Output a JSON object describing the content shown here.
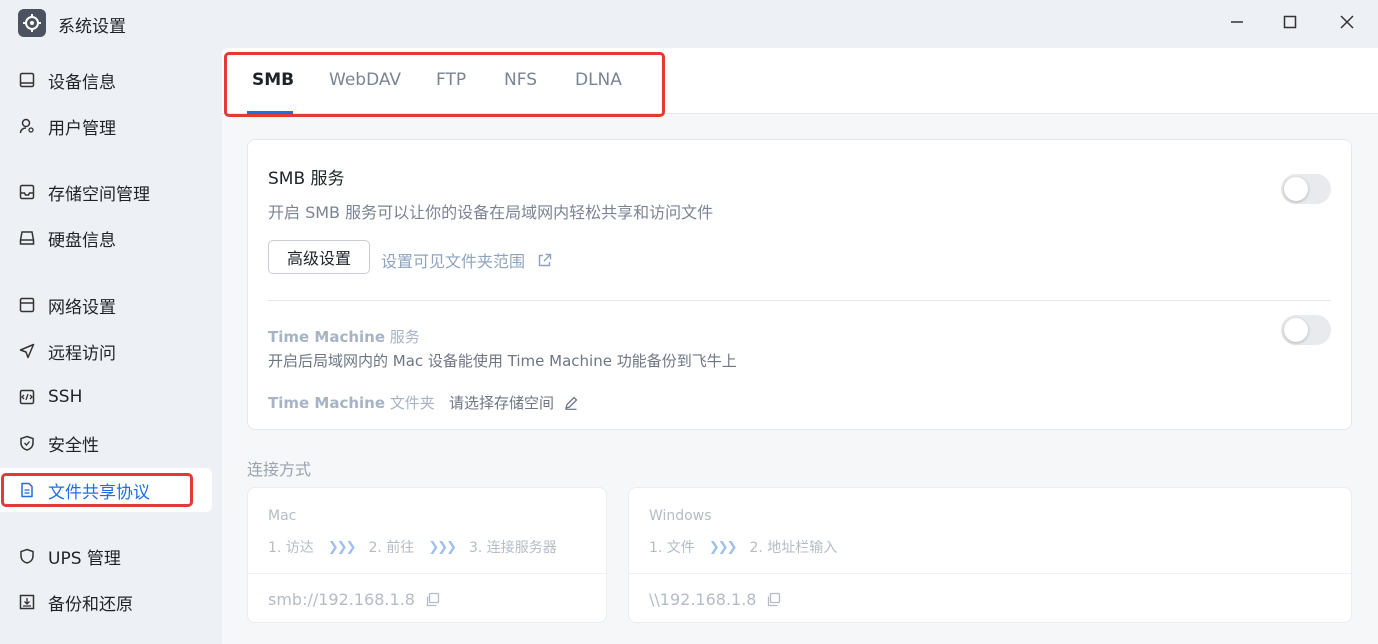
{
  "window": {
    "title": "系统设置",
    "controls": [
      "minimize-icon",
      "maximize-icon",
      "close-icon"
    ]
  },
  "sidebar": {
    "items": [
      {
        "label": "设备信息",
        "icon": "device-info-icon"
      },
      {
        "label": "用户管理",
        "icon": "user-manage-icon"
      },
      {
        "label": "存储空间管理",
        "icon": "storage-icon"
      },
      {
        "label": "硬盘信息",
        "icon": "disk-icon"
      },
      {
        "label": "网络设置",
        "icon": "network-icon"
      },
      {
        "label": "远程访问",
        "icon": "remote-access-icon"
      },
      {
        "label": "SSH",
        "icon": "ssh-icon"
      },
      {
        "label": "安全性",
        "icon": "shield-icon"
      },
      {
        "label": "文件共享协议",
        "icon": "file-share-icon",
        "active": true
      },
      {
        "label": "UPS 管理",
        "icon": "ups-shield-icon"
      },
      {
        "label": "备份和还原",
        "icon": "backup-icon"
      }
    ]
  },
  "tabs": [
    "SMB",
    "WebDAV",
    "FTP",
    "NFS",
    "DLNA"
  ],
  "active_tab": "SMB",
  "smb": {
    "title": "SMB 服务",
    "desc": "开启 SMB 服务可以让你的设备在局域网内轻松共享和访问文件",
    "enabled": false,
    "advanced_button": "高级设置",
    "scope_link": "设置可见文件夹范围"
  },
  "time_machine": {
    "title_bold": "Time Machine",
    "title_rest": " 服务",
    "desc": "开启后局域网内的 Mac 设备能使用 Time Machine 功能备份到飞牛上",
    "enabled": false,
    "folder_label_bold": "Time Machine",
    "folder_label_rest": " 文件夹",
    "choose_storage": "请选择存储空间"
  },
  "connection": {
    "label": "连接方式",
    "arrow": "❯❯❯",
    "mac": {
      "os": "Mac",
      "steps": [
        "1. 访达",
        "2. 前往",
        "3. 连接服务器"
      ],
      "address": "smb://192.168.1.8"
    },
    "windows": {
      "os": "Windows",
      "steps": [
        "1. 文件",
        "2. 地址栏输入"
      ],
      "address": "\\\\192.168.1.8"
    }
  },
  "colors": {
    "accent": "#1e6fe0",
    "highlight_box": "#e53935",
    "sidebar_bg": "#edf0f5",
    "panel_bg": "#f6f7f9"
  }
}
